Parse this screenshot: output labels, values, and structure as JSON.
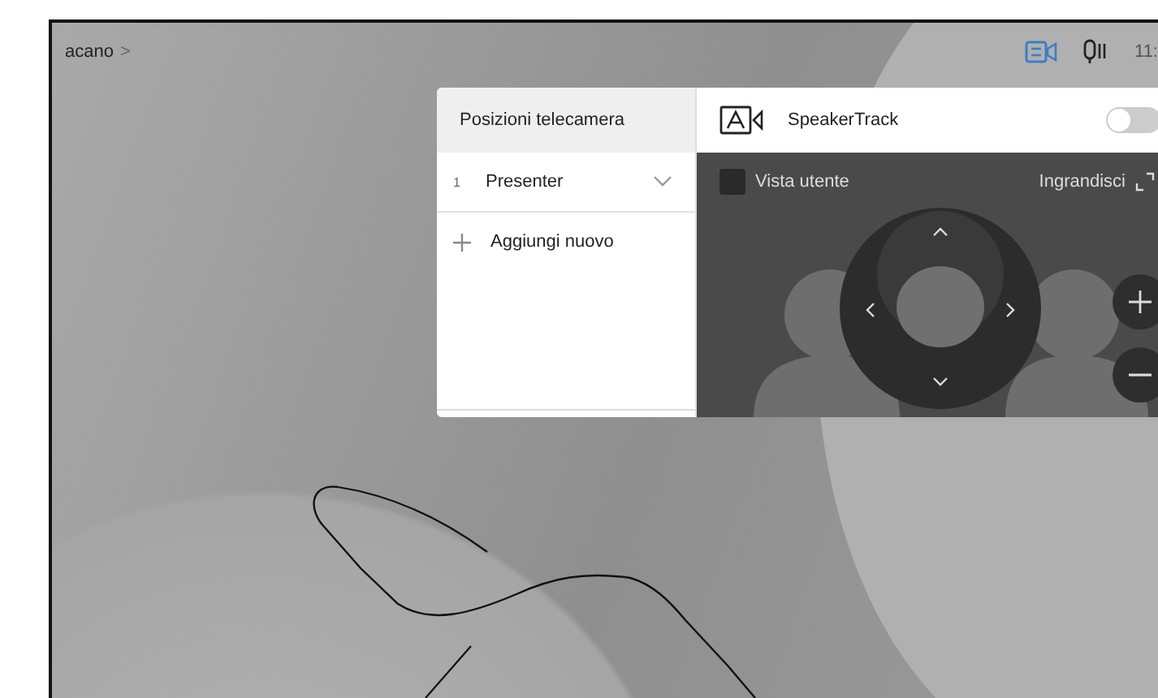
{
  "status_bar": {
    "breadcrumb": "acano",
    "breadcrumb_arrow": ">",
    "time": "11:"
  },
  "camera_panel": {
    "title": "Posizioni telecamera",
    "presets": [
      {
        "number": "1",
        "name": "Presenter"
      }
    ],
    "add_label": "Aggiungi nuovo",
    "speaker_track": {
      "label": "SpeakerTrack",
      "on": false
    },
    "self_view": {
      "label": "Vista utente",
      "checked": false
    },
    "zoom_label": "Ingrandisci"
  }
}
